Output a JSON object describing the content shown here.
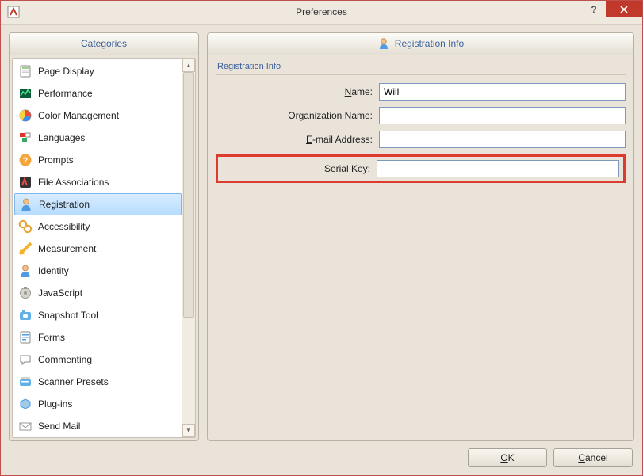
{
  "window": {
    "title": "Preferences"
  },
  "left": {
    "header": "Categories",
    "items": [
      {
        "label": "Page Display",
        "icon": "page-display-icon"
      },
      {
        "label": "Performance",
        "icon": "performance-icon"
      },
      {
        "label": "Color Management",
        "icon": "color-mgmt-icon"
      },
      {
        "label": "Languages",
        "icon": "languages-icon"
      },
      {
        "label": "Prompts",
        "icon": "prompts-icon"
      },
      {
        "label": "File Associations",
        "icon": "file-assoc-icon"
      },
      {
        "label": "Registration",
        "icon": "registration-icon",
        "selected": true
      },
      {
        "label": "Accessibility",
        "icon": "accessibility-icon"
      },
      {
        "label": "Measurement",
        "icon": "measurement-icon"
      },
      {
        "label": "Identity",
        "icon": "identity-icon"
      },
      {
        "label": "JavaScript",
        "icon": "javascript-icon"
      },
      {
        "label": "Snapshot Tool",
        "icon": "snapshot-icon"
      },
      {
        "label": "Forms",
        "icon": "forms-icon"
      },
      {
        "label": "Commenting",
        "icon": "commenting-icon"
      },
      {
        "label": "Scanner Presets",
        "icon": "scanner-icon"
      },
      {
        "label": "Plug-ins",
        "icon": "plugins-icon"
      },
      {
        "label": "Send Mail",
        "icon": "sendmail-icon"
      }
    ]
  },
  "right": {
    "header": "Registration Info",
    "group_title": "Registration Info",
    "name_label_pre": "",
    "name_label_u": "N",
    "name_label_post": "ame:",
    "name_value": "Will",
    "org_label_pre": "",
    "org_label_u": "O",
    "org_label_post": "rganization Name:",
    "org_value": "",
    "email_label_pre": "",
    "email_label_u": "E",
    "email_label_post": "-mail Address:",
    "email_value": "",
    "serial_label_pre": "",
    "serial_label_u": "S",
    "serial_label_post": "erial Key:",
    "serial_value": ""
  },
  "footer": {
    "ok_pre": "",
    "ok_u": "O",
    "ok_post": "K",
    "cancel_pre": "",
    "cancel_u": "C",
    "cancel_post": "ancel"
  }
}
